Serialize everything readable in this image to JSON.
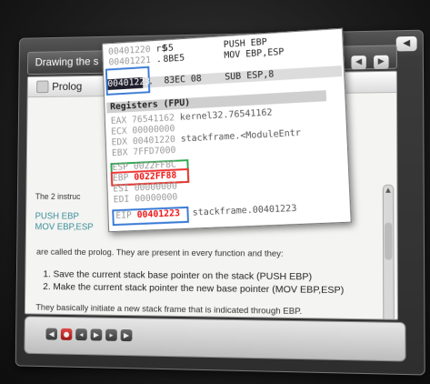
{
  "window": {
    "title": "Drawing the s",
    "close_icon": "◀",
    "nav_prev": "◀",
    "nav_next": "▶"
  },
  "panel": {
    "title": "Prolog",
    "intro": "The 2 instruc",
    "code1": "PUSH EBP",
    "code2": "MOV EBP,ESP",
    "line_a": "are called the prolog. They are present in every function and they:",
    "item1": "1. Save the current stack base pointer on the stack (PUSH EBP)",
    "item2": "2. Make the current stack pointer the new base pointer (MOV EBP,ESP)",
    "line_b": "They basically initiate a new stack frame that is indicated through EBP."
  },
  "debugger": {
    "disasm": [
      {
        "addr": "00401220",
        "sep": "r$",
        "bytes": "55",
        "instr": "PUSH EBP"
      },
      {
        "addr": "00401221",
        "sep": ".",
        "bytes": "8BE5",
        "instr": "MOV EBP,ESP"
      },
      {
        "addr": "00401223",
        "sep": ".",
        "bytes": "83EC 08",
        "instr": "SUB ESP,8"
      }
    ],
    "registers_title": "Registers (FPU)",
    "regs": [
      {
        "name": "EAX",
        "value": "76541162",
        "info": "kernel32.76541162"
      },
      {
        "name": "ECX",
        "value": "00000000",
        "info": ""
      },
      {
        "name": "EDX",
        "value": "00401220",
        "info": "stackframe.<ModuleEntr"
      },
      {
        "name": "EBX",
        "value": "7FFD7000",
        "info": ""
      },
      {
        "name": "ESP",
        "value": "0022FF8C",
        "info": ""
      },
      {
        "name": "EBP",
        "value": "0022FF88",
        "info": ""
      },
      {
        "name": "ESI",
        "value": "00000000",
        "info": ""
      },
      {
        "name": "EDI",
        "value": "00000000",
        "info": ""
      }
    ],
    "eip": {
      "name": "EIP",
      "value": "00401223",
      "info": "stackframe.00401223"
    }
  },
  "colors": {
    "highlight_red": "#e11111",
    "box_green": "#2fa84f",
    "box_blue": "#3a7bd5"
  },
  "toolbar_icons": [
    "media-first-icon",
    "record-icon",
    "rewind-icon",
    "play-icon",
    "forward-icon",
    "media-last-icon"
  ]
}
